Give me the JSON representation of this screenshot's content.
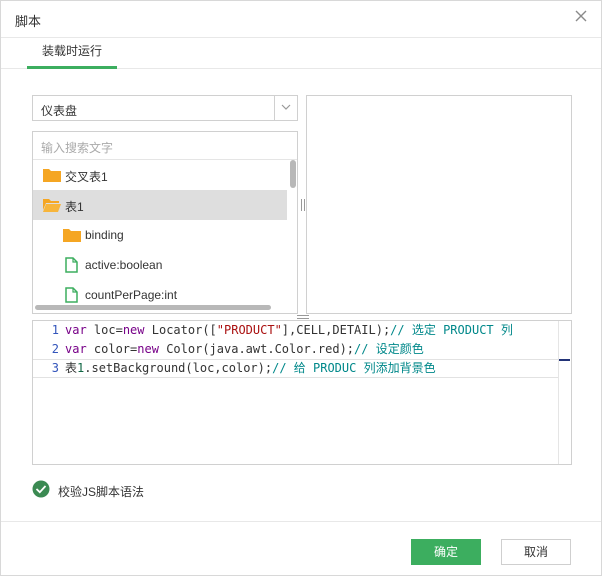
{
  "dialog": {
    "title": "脚本",
    "tabs": [
      {
        "label": "装载时运行",
        "active": true
      }
    ]
  },
  "left_panel": {
    "dropdown_value": "仪表盘",
    "search_placeholder": "输入搜索文字",
    "tree": [
      {
        "label": "交叉表1",
        "icon": "folder-icon",
        "depth": 0,
        "selected": false
      },
      {
        "label": "表1",
        "icon": "folder-open-icon",
        "depth": 0,
        "selected": true
      },
      {
        "label": "binding",
        "icon": "folder-icon",
        "depth": 1,
        "selected": false
      },
      {
        "label": "active:boolean",
        "icon": "file-icon",
        "depth": 1,
        "selected": false
      },
      {
        "label": "countPerPage:int",
        "icon": "file-icon",
        "depth": 1,
        "selected": false
      }
    ]
  },
  "editor": {
    "lines": [
      {
        "n": "1",
        "segments": [
          {
            "t": "var",
            "c": "kw"
          },
          {
            "t": " loc",
            "c": ""
          },
          {
            "t": "=",
            "c": ""
          },
          {
            "t": "new",
            "c": "kw"
          },
          {
            "t": " Locator([",
            "c": ""
          },
          {
            "t": "\"PRODUCT\"",
            "c": "str"
          },
          {
            "t": "],CELL,DETAIL);",
            "c": ""
          },
          {
            "t": "// 选定 PRODUCT 列",
            "c": "cm"
          }
        ]
      },
      {
        "n": "2",
        "segments": [
          {
            "t": "var",
            "c": "kw"
          },
          {
            "t": " color",
            "c": ""
          },
          {
            "t": "=",
            "c": ""
          },
          {
            "t": "new",
            "c": "kw"
          },
          {
            "t": " Color(java.awt.Color.red);",
            "c": ""
          },
          {
            "t": "// 设定颜色",
            "c": "cm"
          }
        ]
      },
      {
        "n": "3",
        "segments": [
          {
            "t": "表",
            "c": ""
          },
          {
            "t": "1",
            "c": "num"
          },
          {
            "t": ".setBackground(loc,color);",
            "c": ""
          },
          {
            "t": "// 给 PRODUC 列添加背景色",
            "c": "cm"
          }
        ]
      }
    ]
  },
  "validate": {
    "label": "校验JS脚本语法",
    "checked": true
  },
  "footer": {
    "ok_label": "确定",
    "cancel_label": "取消"
  },
  "colors": {
    "accent": "#3cae5f",
    "folder": "#f5a623",
    "file": "#3cae5f"
  }
}
